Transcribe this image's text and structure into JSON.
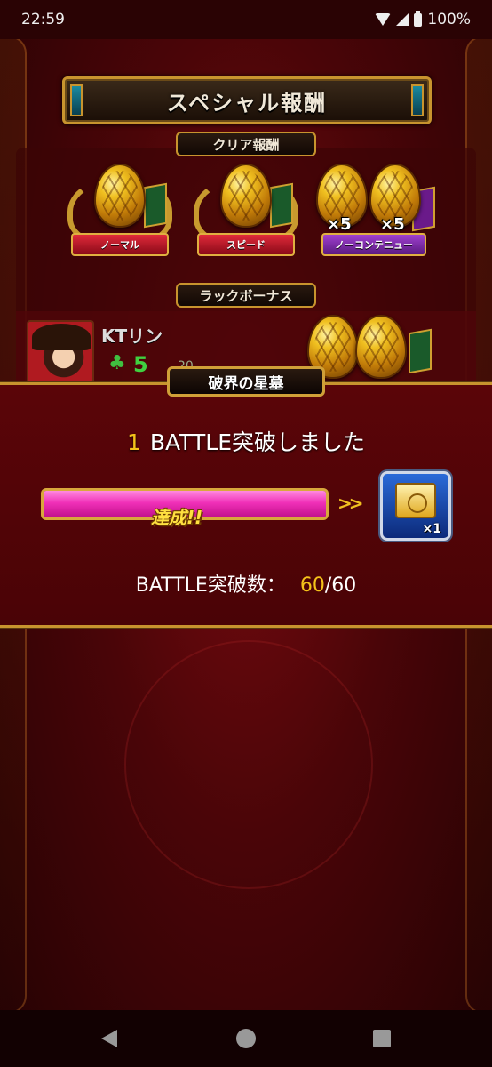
{
  "status_bar": {
    "time": "22:59",
    "battery": "100%",
    "icons": [
      "wifi-icon",
      "cell-signal-icon",
      "battery-icon"
    ]
  },
  "special_reward": {
    "title": "スペシャル報酬",
    "clear_reward_label": "クリア報酬",
    "rewards": [
      {
        "label": "ノーマル",
        "multiplier": "",
        "color": "#c01828"
      },
      {
        "label": "スピード",
        "multiplier": "",
        "color": "#c01828"
      },
      {
        "label": "ノーコンテニュー",
        "multiplier": "×5",
        "multiplier2": "×5",
        "color": "#8a2ab8"
      }
    ],
    "luck_bonus_label": "ラックボーナス",
    "player": {
      "name": "KTリン",
      "luck": "5",
      "extra": "20"
    }
  },
  "dialog": {
    "title": "破界の星墓",
    "battle_num": "1",
    "battle_text": "BATTLE突破しました",
    "progress": 1.0,
    "achieved_text": "達成!!",
    "arrows": ">>",
    "reward_qty": "×1",
    "count_label": "BATTLE突破数：",
    "count_current": "60",
    "count_total": "/60"
  },
  "colors": {
    "accent_gold": "#c8942e",
    "highlight_yellow": "#f4c21a",
    "progress_pink": "#f030b8"
  }
}
